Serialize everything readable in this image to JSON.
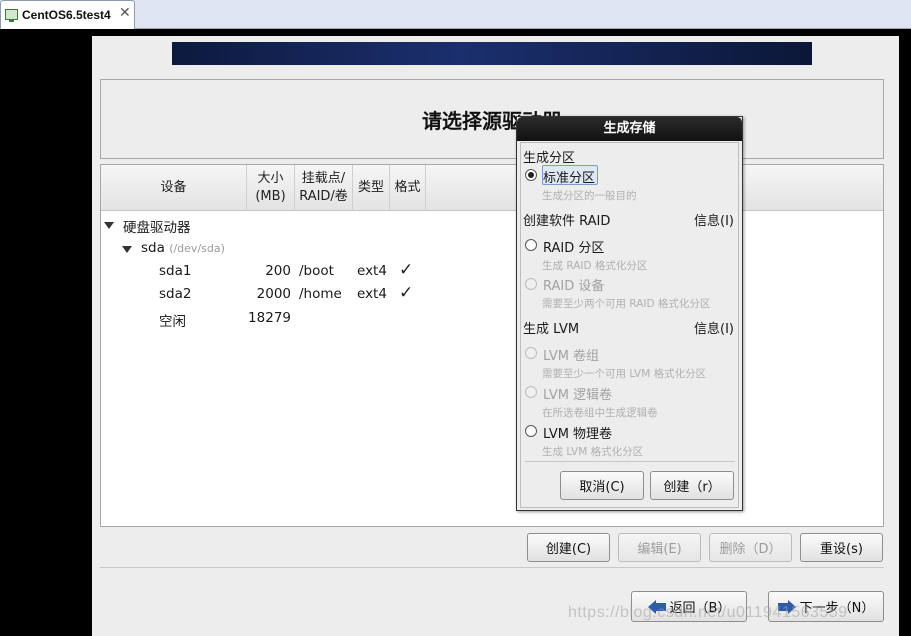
{
  "vm_tab": {
    "title": "CentOS6.5test4",
    "close": "✕"
  },
  "page": {
    "title": "请选择源驱动器"
  },
  "table": {
    "headers": {
      "device": "设备",
      "size_line1": "大小",
      "size_line2": "(MB)",
      "mount_line1": "挂载点/",
      "mount_line2": "RAID/卷",
      "type": "类型",
      "format": "格式"
    },
    "group": "硬盘驱动器",
    "disk": {
      "name": "sda",
      "path": "(/dev/sda)"
    },
    "rows": [
      {
        "device": "sda1",
        "size": "200",
        "mount": "/boot",
        "type": "ext4",
        "format": "✓"
      },
      {
        "device": "sda2",
        "size": "2000",
        "mount": "/home",
        "type": "ext4",
        "format": "✓"
      },
      {
        "device": "空闲",
        "size": "18279",
        "mount": "",
        "type": "",
        "format": ""
      }
    ]
  },
  "actions": {
    "create": "创建(C)",
    "edit": "编辑(E)",
    "delete": "删除（D）",
    "reset": "重设(s)"
  },
  "nav": {
    "back": "返回（B）",
    "next": "下一步（N）"
  },
  "dialog": {
    "title": "生成存储",
    "section_partition": "生成分区",
    "standard_partition": "标准分区",
    "standard_partition_desc": "生成分区的一般目的",
    "section_raid": "创建软件 RAID",
    "raid_info": "信息(I)",
    "raid_partition": "RAID 分区",
    "raid_partition_desc": "生成 RAID 格式化分区",
    "raid_device": "RAID 设备",
    "raid_device_desc": "需要至少两个可用 RAID 格式化分区",
    "section_lvm": "生成 LVM",
    "lvm_info": "信息(I)",
    "lvm_vg": "LVM 卷组",
    "lvm_vg_desc": "需要至少一个可用 LVM 格式化分区",
    "lvm_lv": "LVM 逻辑卷",
    "lvm_lv_desc": "在所选卷组中生成逻辑卷",
    "lvm_pv": "LVM 物理卷",
    "lvm_pv_desc": "生成 LVM 格式化分区",
    "cancel": "取消(C)",
    "create": "创建（r）"
  },
  "watermark": "https://blog.csdn.net/u011941563559"
}
